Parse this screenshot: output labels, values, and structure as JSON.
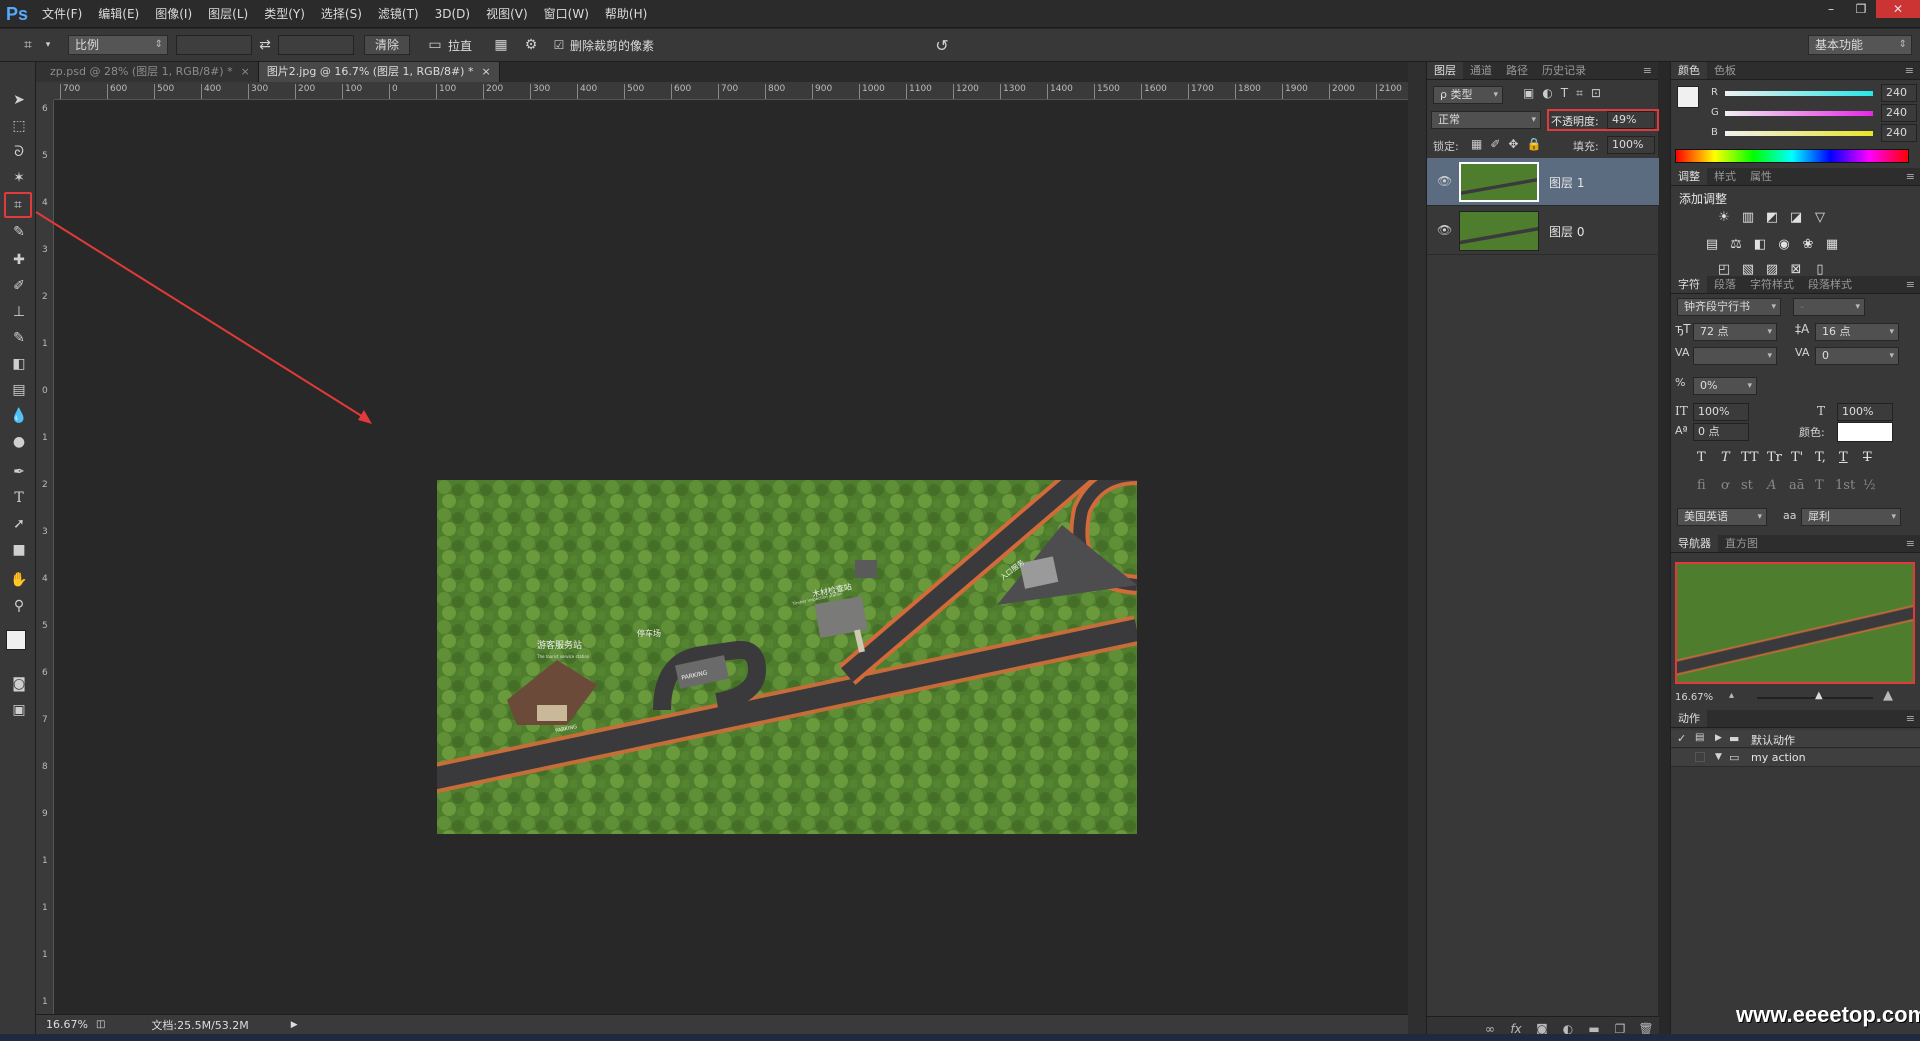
{
  "app": {
    "logo": "Ps"
  },
  "menu": [
    "文件(F)",
    "编辑(E)",
    "图像(I)",
    "图层(L)",
    "类型(Y)",
    "选择(S)",
    "滤镜(T)",
    "3D(D)",
    "视图(V)",
    "窗口(W)",
    "帮助(H)"
  ],
  "window_controls": {
    "minimize": "–",
    "restore": "❐",
    "close": "✕"
  },
  "options": {
    "ratio_select": "比例",
    "clear_button": "清除",
    "straighten_label": "拉直",
    "delete_cropped_label": "删除裁剪的像素",
    "delete_cropped_checked": true,
    "workspace_select": "基本功能"
  },
  "tabs": [
    {
      "label": "zp.psd @ 28% (图层 1, RGB/8#) *",
      "active": false
    },
    {
      "label": "图片2.jpg @ 16.7% (图层 1, RGB/8#) *",
      "active": true
    }
  ],
  "ruler": {
    "h_labels": [
      "700",
      "600",
      "500",
      "400",
      "300",
      "200",
      "100",
      "0",
      "100",
      "200",
      "300",
      "400",
      "500",
      "600",
      "700",
      "800",
      "900",
      "1000",
      "1100",
      "1200",
      "1300",
      "1400",
      "1500",
      "1600",
      "1700",
      "1800",
      "1900",
      "2000",
      "2100"
    ],
    "v_labels": [
      "6",
      "5",
      "4",
      "3",
      "2",
      "1",
      "0",
      "1",
      "2",
      "3",
      "4",
      "5",
      "6",
      "7",
      "8",
      "9",
      "1",
      "1",
      "1",
      "1"
    ]
  },
  "image_labels": {
    "visitor_station": "游客服务站",
    "visitor_station_en": "The tourist service station",
    "parking_cn": "停车场",
    "parking": "PARKING",
    "parking2": "PARKING",
    "wood_station": "木材检查站",
    "wood_station_en": "Timber inspection station",
    "entrance": "入口服务"
  },
  "status": {
    "zoom": "16.67%",
    "doc": "文档:25.5M/53.2M"
  },
  "layers_panel": {
    "tabs": [
      "图层",
      "通道",
      "路径",
      "历史记录"
    ],
    "filter_select": "ρ 类型",
    "blend_mode": "正常",
    "opacity_label": "不透明度:",
    "opacity_value": "49%",
    "lock_label": "锁定:",
    "fill_label": "填充:",
    "fill_value": "100%",
    "layers": [
      {
        "name": "图层 1",
        "selected": true
      },
      {
        "name": "图层 0",
        "selected": false
      }
    ],
    "bottom_icons": [
      "link-icon",
      "fx-icon",
      "mask-icon",
      "adjustment-icon",
      "folder-icon",
      "new-layer-icon",
      "trash-icon"
    ]
  },
  "color_panel": {
    "tabs": [
      "颜色",
      "色板"
    ],
    "channels": [
      {
        "name": "R",
        "value": "240",
        "color": "#28e6e6"
      },
      {
        "name": "G",
        "value": "240",
        "color": "#e628e6"
      },
      {
        "name": "B",
        "value": "240",
        "color": "#e6e628"
      }
    ]
  },
  "adjust_panel": {
    "tabs": [
      "调整",
      "样式",
      "属性"
    ],
    "title": "添加调整"
  },
  "character_panel": {
    "tabs": [
      "字符",
      "段落",
      "字符样式",
      "段落样式"
    ],
    "font_family": "钟齐段宁行书",
    "font_style": "-",
    "font_size": "72 点",
    "leading": "16 点",
    "kerning": "",
    "tracking": "0",
    "scale_pct": "0%",
    "vscale": "100%",
    "hscale": "100%",
    "baseline": "0 点",
    "color_label": "颜色:",
    "language": "美国英语",
    "aa_label": "a",
    "antialias": "犀利",
    "style_glyphs": [
      "T",
      "T",
      "TT",
      "Tr",
      "T'",
      "T,",
      "T",
      "T"
    ],
    "ot_glyphs": [
      "fi",
      "ơ",
      "st",
      "A",
      "aā",
      "T",
      "1st",
      "½"
    ]
  },
  "navigator_panel": {
    "tabs": [
      "导航器",
      "直方图"
    ],
    "zoom": "16.67%"
  },
  "actions_panel": {
    "tabs": [
      "动作"
    ],
    "items": [
      {
        "label": "默认动作",
        "expanded": false,
        "checked": true
      },
      {
        "label": "my action",
        "expanded": true,
        "checked": false
      }
    ]
  },
  "watermark": "www.eeeetop.com"
}
